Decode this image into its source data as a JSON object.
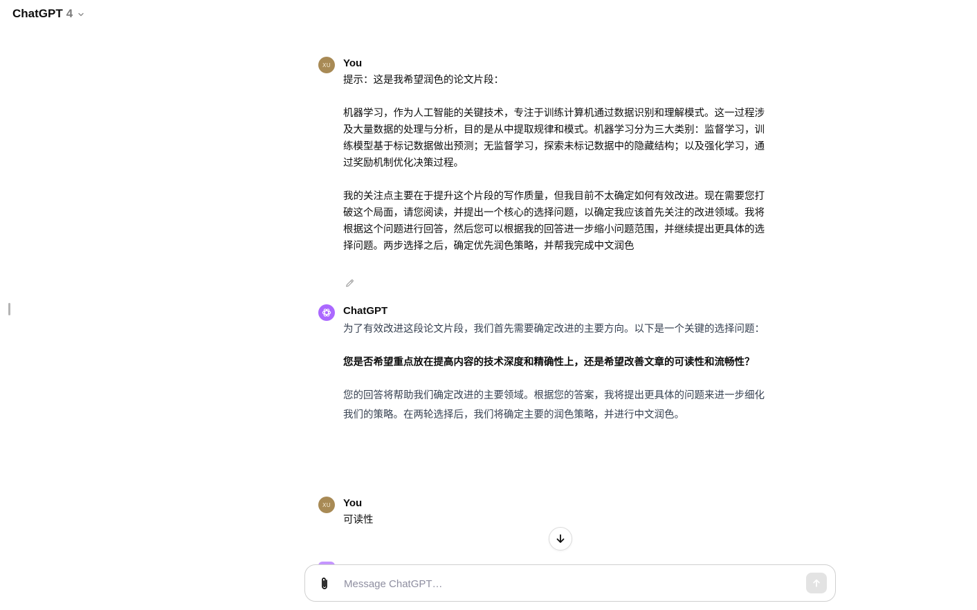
{
  "header": {
    "model_name": "ChatGPT",
    "model_version": "4",
    "chevron_icon": "chevron-down-icon"
  },
  "messages": [
    {
      "role": "user",
      "author": "You",
      "avatar_initials": "XU",
      "paragraphs": [
        "提示：这是我希望润色的论文片段：",
        "机器学习，作为人工智能的关键技术，专注于训练计算机通过数据识别和理解模式。这一过程涉及大量数据的处理与分析，目的是从中提取规律和模式。机器学习分为三大类别：监督学习，训练模型基于标记数据做出预测；无监督学习，探索未标记数据中的隐藏结构；以及强化学习，通过奖励机制优化决策过程。",
        "我的关注点主要在于提升这个片段的写作质量，但我目前不太确定如何有效改进。现在需要您打破这个局面，请您阅读，并提出一个核心的选择问题，以确定我应该首先关注的改进领域。我将根据这个问题进行回答，然后您可以根据我的回答进一步缩小问题范围，并继续提出更具体的选择问题。两步选择之后，确定优先润色策略，并帮我完成中文润色"
      ],
      "edit_icon": "pencil-icon"
    },
    {
      "role": "assistant",
      "author": "ChatGPT",
      "avatar_icon": "openai-logo-icon",
      "paragraphs": [
        "为了有效改进这段论文片段，我们首先需要确定改进的主要方向。以下是一个关键的选择问题：",
        "您是否希望重点放在提高内容的技术深度和精确性上，还是希望改善文章的可读性和流畅性？",
        "您的回答将帮助我们确定改进的主要领域。根据您的答案，我将提出更具体的问题来进一步细化我们的策略。在两轮选择后，我们将确定主要的润色策略，并进行中文润色。"
      ]
    },
    {
      "role": "user",
      "author": "You",
      "avatar_initials": "XU",
      "paragraphs": [
        "可读性"
      ]
    }
  ],
  "scroll_button": {
    "icon": "arrow-down-icon"
  },
  "composer": {
    "placeholder": "Message ChatGPT…",
    "value": "",
    "attach_icon": "paperclip-icon",
    "send_icon": "arrow-up-icon"
  },
  "colors": {
    "user_avatar": "#a88a55",
    "assistant_avatar": "#ab68ff",
    "send_button_disabled": "#e3e3e3"
  }
}
